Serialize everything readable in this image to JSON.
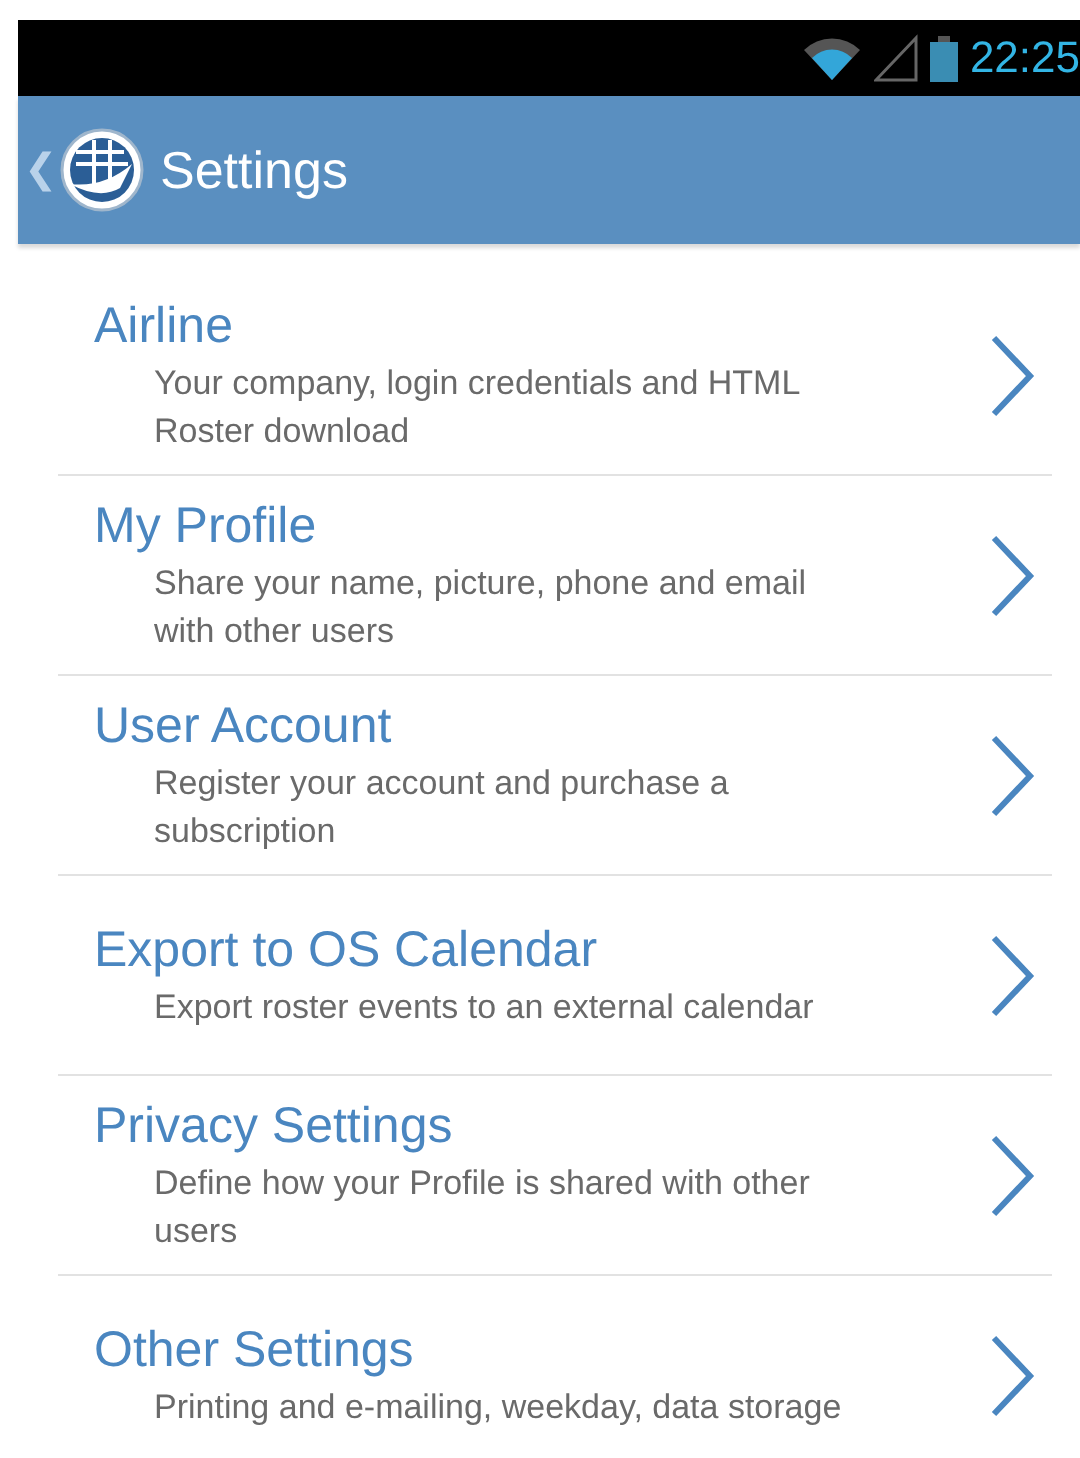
{
  "status_bar": {
    "time": "22:25"
  },
  "header": {
    "back": "❮",
    "title": "Settings"
  },
  "items": [
    {
      "title": "Airline",
      "description": "Your company, login credentials and HTML Roster download"
    },
    {
      "title": "My Profile",
      "description": "Share your name, picture, phone and email with other users"
    },
    {
      "title": "User Account",
      "description": "Register your account and purchase a subscription"
    },
    {
      "title": "Export to OS Calendar",
      "description": "Export roster events to an external calendar"
    },
    {
      "title": "Privacy Settings",
      "description": "Define how your Profile is shared with other users"
    },
    {
      "title": "Other Settings",
      "description": "Printing and e-mailing, weekday, data storage"
    }
  ]
}
